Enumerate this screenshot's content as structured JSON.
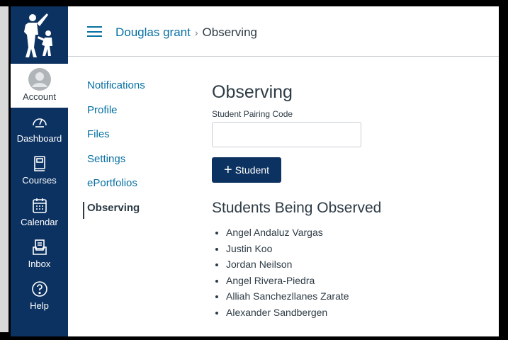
{
  "nav": {
    "account": "Account",
    "items": [
      {
        "label": "Dashboard",
        "icon": "dashboard-icon"
      },
      {
        "label": "Courses",
        "icon": "courses-icon"
      },
      {
        "label": "Calendar",
        "icon": "calendar-icon"
      },
      {
        "label": "Inbox",
        "icon": "inbox-icon"
      },
      {
        "label": "Help",
        "icon": "help-icon"
      }
    ]
  },
  "breadcrumb": {
    "user": "Douglas grant",
    "separator": "›",
    "current": "Observing"
  },
  "menu": [
    "Notifications",
    "Profile",
    "Files",
    "Settings",
    "ePortfolios",
    "Observing"
  ],
  "page": {
    "title": "Observing",
    "code_label": "Student Pairing Code",
    "code_value": "",
    "add_button": "Student",
    "list_title": "Students Being Observed"
  },
  "students": [
    "Angel Andaluz Vargas",
    "Justin Koo",
    "Jordan Neilson",
    "Angel Rivera-Piedra",
    "Alliah Sanchezllanes Zarate",
    "Alexander Sandbergen"
  ],
  "colors": {
    "nav_bg": "#0c3261",
    "link": "#0770a3",
    "text": "#2d3b45"
  }
}
